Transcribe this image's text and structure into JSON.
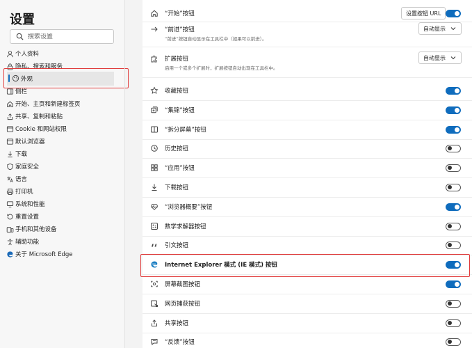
{
  "sidebar": {
    "title": "设置",
    "search_placeholder": "搜索设置",
    "items": [
      {
        "label": "个人资料",
        "icon": "profile-icon"
      },
      {
        "label": "隐私、搜索和服务",
        "icon": "lock-icon"
      },
      {
        "label": "外观",
        "icon": "appearance-icon",
        "active": true
      },
      {
        "label": "侧栏",
        "icon": "sidebar-icon"
      },
      {
        "label": "开始、主页和新建标签页",
        "icon": "home-icon"
      },
      {
        "label": "共享、复制和粘贴",
        "icon": "share-icon"
      },
      {
        "label": "Cookie 和网站权限",
        "icon": "site-permissions-icon"
      },
      {
        "label": "默认浏览器",
        "icon": "browser-icon"
      },
      {
        "label": "下载",
        "icon": "download-icon"
      },
      {
        "label": "家庭安全",
        "icon": "family-icon"
      },
      {
        "label": "语言",
        "icon": "language-icon"
      },
      {
        "label": "打印机",
        "icon": "printer-icon"
      },
      {
        "label": "系统和性能",
        "icon": "system-icon"
      },
      {
        "label": "重置设置",
        "icon": "reset-icon"
      },
      {
        "label": "手机和其他设备",
        "icon": "phone-icon"
      },
      {
        "label": "辅助功能",
        "icon": "accessibility-icon"
      },
      {
        "label": "关于 Microsoft Edge",
        "icon": "edge-icon"
      }
    ]
  },
  "main": {
    "rows": [
      {
        "label": "“开始”按钮",
        "icon": "home-icon",
        "control": "toggle",
        "on": true,
        "button": "设置按钮 URL"
      },
      {
        "label": "“前进”按钮",
        "icon": "forward-arrow-icon",
        "control": "dropdown",
        "value": "自动显示",
        "desc": "“前进”按钮自动显示在工具栏中（如果可以前进）。"
      },
      {
        "label": "扩展按钮",
        "icon": "puzzle-icon",
        "control": "dropdown",
        "value": "自动显示",
        "desc": "启用一个或多个扩展时，扩展按钮自动出现在工具栏中。"
      },
      {
        "label": "收藏按钮",
        "icon": "star-icon",
        "control": "toggle",
        "on": true
      },
      {
        "label": "“集锦”按钮",
        "icon": "collections-icon",
        "control": "toggle",
        "on": true
      },
      {
        "label": "“拆分屏幕”按钮",
        "icon": "split-screen-icon",
        "control": "toggle",
        "on": true
      },
      {
        "label": "历史按钮",
        "icon": "history-icon",
        "control": "toggle",
        "on": false
      },
      {
        "label": "“应用”按钮",
        "icon": "apps-icon",
        "control": "toggle",
        "on": false
      },
      {
        "label": "下载按钮",
        "icon": "download-icon",
        "control": "toggle",
        "on": false
      },
      {
        "label": "“浏览器概要”按钮",
        "icon": "heartbeat-icon",
        "control": "toggle",
        "on": true
      },
      {
        "label": "数学求解器按钮",
        "icon": "math-solver-icon",
        "control": "toggle",
        "on": false
      },
      {
        "label": "引文按钮",
        "icon": "quote-icon",
        "control": "toggle",
        "on": false
      },
      {
        "label": "Internet Explorer 模式 (IE 模式) 按钮",
        "icon": "ie-icon",
        "control": "toggle",
        "on": true,
        "bold": true
      },
      {
        "label": "屏幕截图按钮",
        "icon": "screenshot-icon",
        "control": "toggle",
        "on": true
      },
      {
        "label": "网页捕获按钮",
        "icon": "web-capture-icon",
        "control": "toggle",
        "on": false
      },
      {
        "label": "共享按钮",
        "icon": "share-icon",
        "control": "toggle",
        "on": false
      },
      {
        "label": "“反馈”按钮",
        "icon": "feedback-icon",
        "control": "toggle",
        "on": false
      }
    ]
  },
  "colors": {
    "accent": "#0f6cbd",
    "highlight_box": "#e03b3b"
  }
}
